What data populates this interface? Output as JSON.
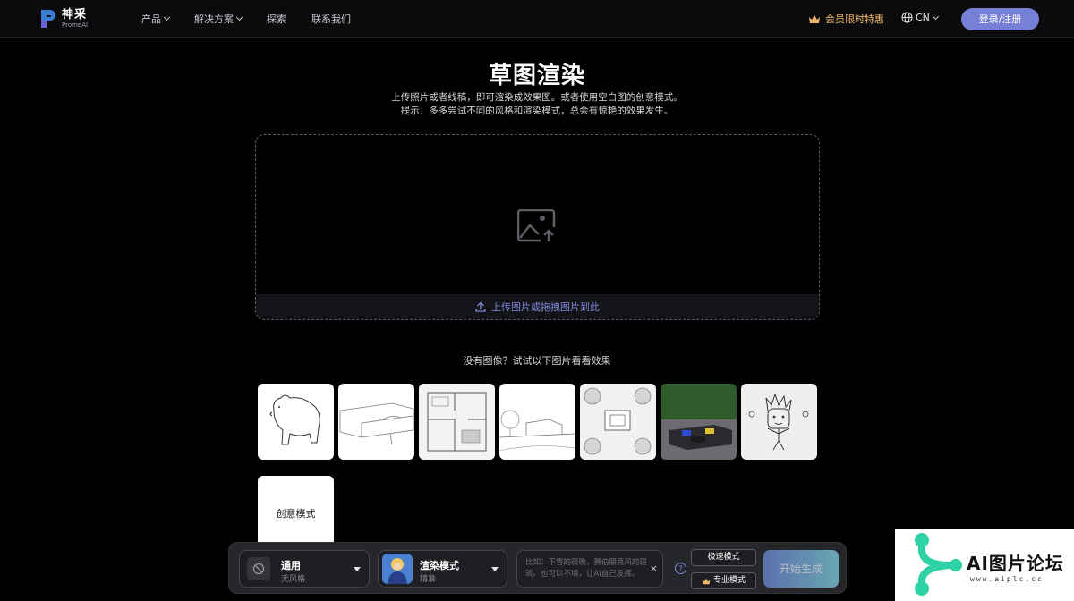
{
  "header": {
    "logo_cn": "神采",
    "logo_en": "PromeAI",
    "nav": [
      {
        "label": "产品",
        "has_dropdown": true
      },
      {
        "label": "解决方案",
        "has_dropdown": true
      },
      {
        "label": "探索",
        "has_dropdown": false
      },
      {
        "label": "联系我们",
        "has_dropdown": false
      }
    ],
    "vip_label": "会员限时特惠",
    "lang_label": "CN",
    "login_label": "登录/注册"
  },
  "hero": {
    "title": "草图渲染",
    "line1": "上传照片或者线稿，即可渲染成效果图。或者使用空白图的创意模式。",
    "line2": "提示：多多尝试不同的风格和渲染模式，总会有惊艳的效果发生。"
  },
  "upload": {
    "label": "上传图片或拖拽图片到此",
    "icon": "image-upload-icon"
  },
  "samples": {
    "title": "没有图像？试试以下图片看看效果",
    "items": [
      "bear-sketch",
      "sofa-sketch",
      "interior-sketch",
      "landscape-sketch",
      "garden-plan-sketch",
      "patio-photo",
      "kid-drawing"
    ],
    "creative_label": "创意模式"
  },
  "toolbar": {
    "style_name": "通用",
    "style_sub": "无风格",
    "mode_name": "渲染模式",
    "mode_sub": "精准",
    "prompt_placeholder": "比如：下雪的夜晚，赛伯朋克风的建筑。也可以不填，让AI自己发挥。",
    "clear": "×",
    "help": "?",
    "speed_label": "极速模式",
    "pro_label": "专业模式",
    "generate_label": "开始生成"
  },
  "watermark": {
    "title": "AI图片论坛",
    "url": "www.aiplc.cc"
  },
  "colors": {
    "accent": "#7680d6",
    "vip": "#f2b96b",
    "link": "#7e86dd"
  }
}
